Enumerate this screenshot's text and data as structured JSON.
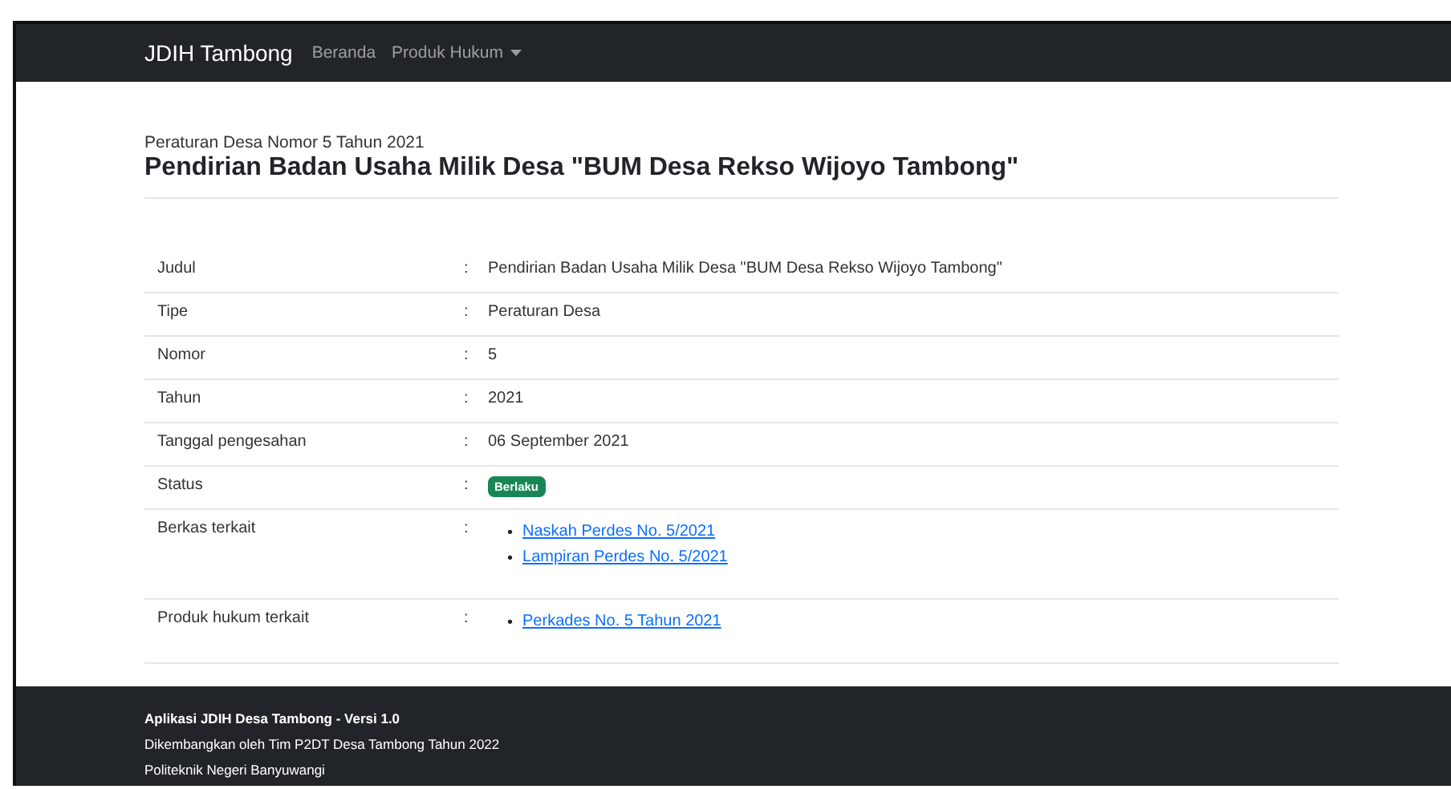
{
  "navbar": {
    "brand": "JDIH Tambong",
    "links": [
      {
        "label": "Beranda",
        "dropdown": false
      },
      {
        "label": "Produk Hukum",
        "dropdown": true
      }
    ]
  },
  "header": {
    "subtitle": "Peraturan Desa Nomor 5 Tahun 2021",
    "title": "Pendirian Badan Usaha Milik Desa \"BUM Desa Rekso Wijoyo Tambong\""
  },
  "details": [
    {
      "label": "Judul",
      "separator": ":",
      "kind": "text",
      "value": "Pendirian Badan Usaha Milik Desa \"BUM Desa Rekso Wijoyo Tambong\""
    },
    {
      "label": "Tipe",
      "separator": ":",
      "kind": "text",
      "value": "Peraturan Desa"
    },
    {
      "label": "Nomor",
      "separator": ":",
      "kind": "text",
      "value": "5"
    },
    {
      "label": "Tahun",
      "separator": ":",
      "kind": "text",
      "value": "2021"
    },
    {
      "label": "Tanggal pengesahan",
      "separator": ":",
      "kind": "text",
      "value": "06 September 2021"
    },
    {
      "label": "Status",
      "separator": ":",
      "kind": "badge",
      "value": "Berlaku",
      "color": "#198754"
    },
    {
      "label": "Berkas terkait",
      "separator": ":",
      "kind": "links",
      "links": [
        {
          "marker": "•",
          "label": "Naskah Perdes No. 5/2021"
        },
        {
          "marker": "•",
          "label": "Lampiran Perdes No. 5/2021"
        }
      ]
    },
    {
      "label": "Produk hukum terkait",
      "separator": ":",
      "kind": "links",
      "links": [
        {
          "marker": "•",
          "label": "Perkades No. 5 Tahun 2021"
        }
      ]
    }
  ],
  "footer": {
    "title": "Aplikasi JDIH Desa Tambong - Versi 1.0",
    "lines": [
      "Dikembangkan oleh Tim P2DT Desa Tambong Tahun 2022",
      "Politeknik Negeri Banyuwangi"
    ]
  }
}
